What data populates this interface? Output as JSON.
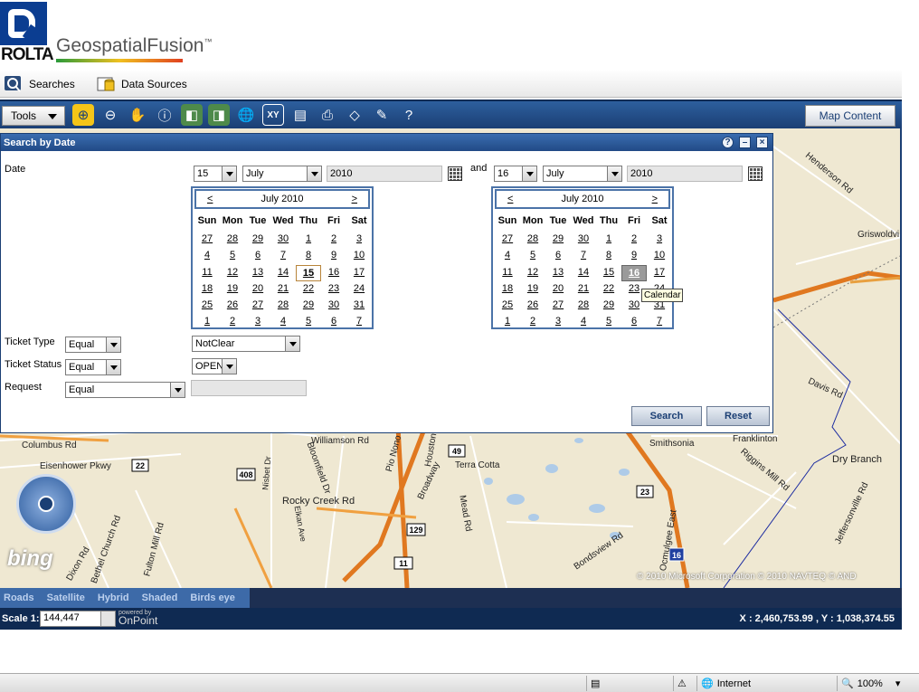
{
  "header": {
    "logo_text": "ROLTA",
    "product_name": "GeospatialFusion",
    "trademark": "™"
  },
  "nav": {
    "searches": "Searches",
    "data_sources": "Data Sources"
  },
  "toolbar": {
    "tools_label": "Tools",
    "map_content_label": "Map Content"
  },
  "panel": {
    "title": "Search by Date",
    "date_label": "Date",
    "and_label": "and",
    "from": {
      "day": "15",
      "month": "July",
      "year": "2010"
    },
    "to": {
      "day": "16",
      "month": "July",
      "year": "2010"
    },
    "cal_weekdays": [
      "Sun",
      "Mon",
      "Tue",
      "Wed",
      "Thu",
      "Fri",
      "Sat"
    ],
    "cal_from": {
      "title": "July 2010",
      "prev": "<",
      "next": ">",
      "selected": 15,
      "days": [
        27,
        28,
        29,
        30,
        1,
        2,
        3,
        4,
        5,
        6,
        7,
        8,
        9,
        10,
        11,
        12,
        13,
        14,
        15,
        16,
        17,
        18,
        19,
        20,
        21,
        22,
        23,
        24,
        25,
        26,
        27,
        28,
        29,
        30,
        31,
        1,
        2,
        3,
        4,
        5,
        6,
        7
      ]
    },
    "cal_to": {
      "title": "July 2010",
      "prev": "<",
      "next": ">",
      "highlighted": 16,
      "days": [
        27,
        28,
        29,
        30,
        1,
        2,
        3,
        4,
        5,
        6,
        7,
        8,
        9,
        10,
        11,
        12,
        13,
        14,
        15,
        16,
        17,
        18,
        19,
        20,
        21,
        22,
        23,
        24,
        25,
        26,
        27,
        28,
        29,
        30,
        31,
        1,
        2,
        3,
        4,
        5,
        6,
        7
      ]
    },
    "tooltip": "Calendar",
    "ticket_type": {
      "label": "Ticket Type",
      "operator": "Equal",
      "value": "NotClear"
    },
    "ticket_status": {
      "label": "Ticket Status",
      "operator": "Equal",
      "value": "OPEN"
    },
    "request": {
      "label": "Request",
      "operator": "Equal",
      "value": ""
    },
    "search_button": "Search",
    "reset_button": "Reset"
  },
  "map": {
    "labels": [
      "Henderson Rd",
      "Griswoldvi",
      "Davis Rd",
      "Smithsonia",
      "Franklinton",
      "Dry Branch",
      "Riggins Mill Rd",
      "Jeffersonville Rd",
      "Columbus Rd",
      "Eisenhower Pkwy",
      "Williamson Rd",
      "Rocky Creek Rd",
      "Terra Cotta",
      "Bethel Church Rd",
      "Fulton Mill Rd",
      "Dixon Rd",
      "Broadway",
      "Houston",
      "Mead Rd",
      "Ocmulgee East",
      "Bondsview Rd",
      "Pio Nono",
      "Bloomfield Dr",
      "Elkan Ave",
      "Nisbet Dr"
    ],
    "route_shields": [
      "22",
      "408",
      "49",
      "129",
      "11",
      "23",
      "16"
    ],
    "attribution": "© 2010 Microsoft Corporation   © 2010 NAVTEQ   © AND",
    "bing": "bing",
    "styles": [
      "Roads",
      "Satellite",
      "Hybrid",
      "Shaded",
      "Birds eye"
    ]
  },
  "statusbar": {
    "scale_label": "Scale 1:",
    "scale_value": "144,447",
    "powered_by": "powered by",
    "powered_brand": "OnPoint",
    "coords": "X : 2,460,753.99 , Y : 1,038,374.55"
  },
  "browser": {
    "zone": "Internet",
    "zoom": "100%"
  },
  "colors": {
    "toolbar": "#1b3f74",
    "panel_title": "#3a6db0",
    "map_bg": "#efe8d2",
    "highway": "#e07820",
    "border_line": "#1a2aa0"
  }
}
